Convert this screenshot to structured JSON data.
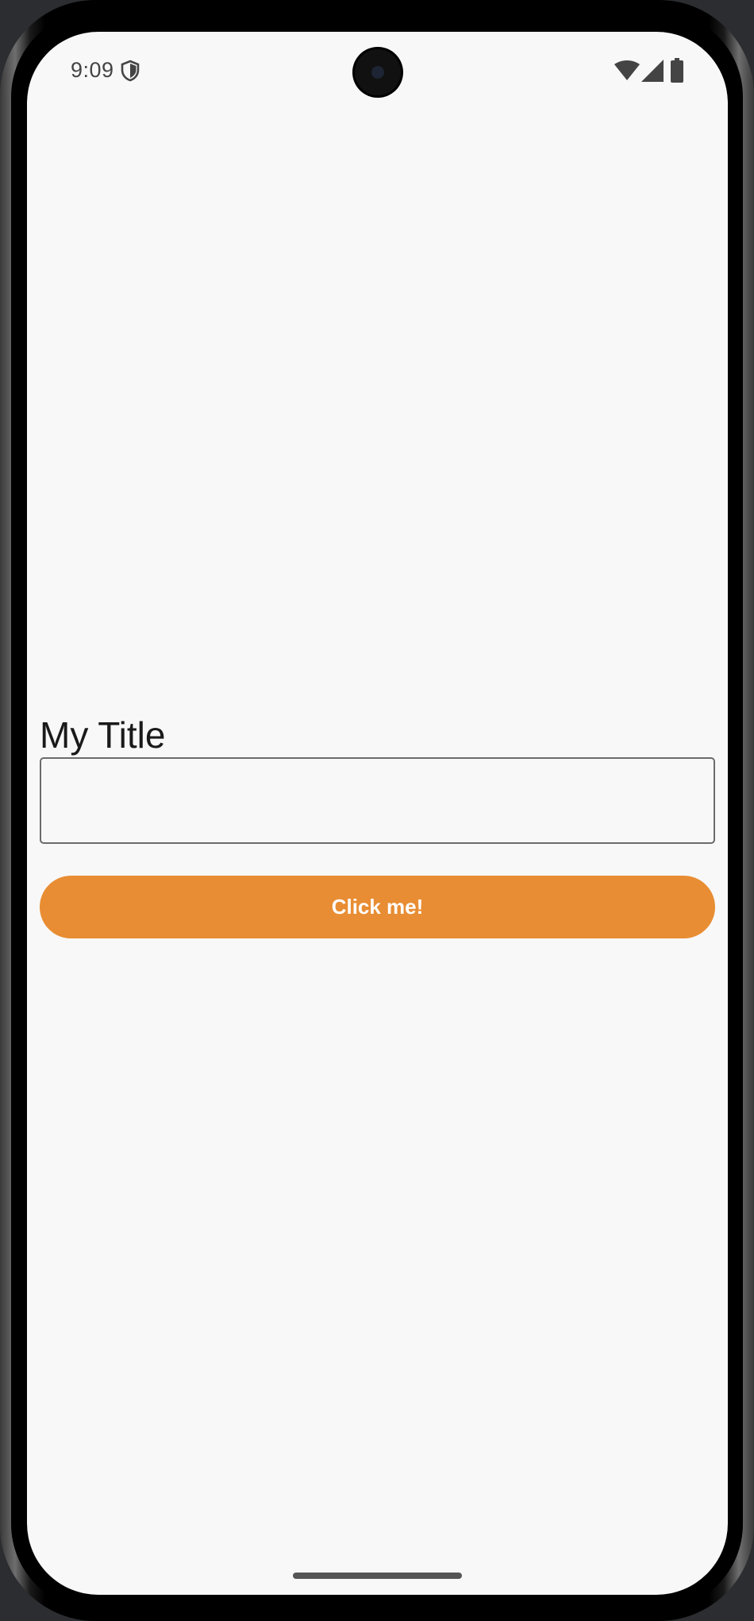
{
  "status_bar": {
    "time": "9:09",
    "icons": [
      "shield-icon",
      "wifi-icon",
      "signal-icon",
      "battery-icon"
    ]
  },
  "main": {
    "title": "My Title",
    "input_value": "",
    "button_label": "Click me!"
  },
  "colors": {
    "accent": "#e88d33",
    "background": "#f8f8f8",
    "button_text": "#ffffff"
  }
}
